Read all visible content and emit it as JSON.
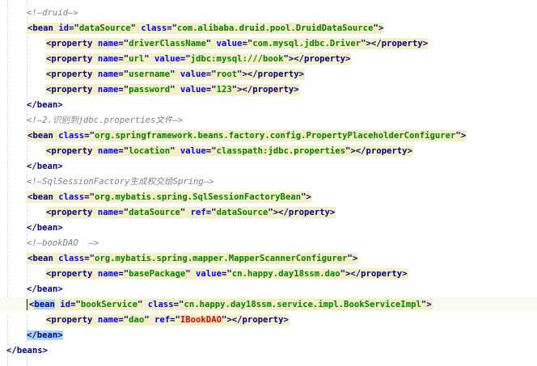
{
  "top_line_partial": "   <!- -------------------------------------------------------------------- ->",
  "lines": [
    {
      "type": "comment",
      "indent": 1,
      "text": "<!—druid—>"
    },
    {
      "type": "tag",
      "indent": 1,
      "open": "bean",
      "attrs": [
        {
          "n": "id",
          "v": "dataSource"
        },
        {
          "n": "class",
          "v": "com.alibaba.druid.pool.DruidDataSource"
        }
      ],
      "close": ">"
    },
    {
      "type": "tag",
      "indent": 2,
      "open": "property",
      "attrs": [
        {
          "n": "name",
          "v": "driverClassName"
        },
        {
          "n": "value",
          "v": "com.mysql.jdbc.Driver"
        }
      ],
      "close": "></property>"
    },
    {
      "type": "tag",
      "indent": 2,
      "open": "property",
      "attrs": [
        {
          "n": "name",
          "v": "url"
        },
        {
          "n": "value",
          "v": "jdbc:mysql:///book"
        }
      ],
      "close": "></property>"
    },
    {
      "type": "tag",
      "indent": 2,
      "open": "property",
      "attrs": [
        {
          "n": "name",
          "v": "username"
        },
        {
          "n": "value",
          "v": "root"
        }
      ],
      "close": "></property>"
    },
    {
      "type": "tag",
      "indent": 2,
      "open": "property",
      "attrs": [
        {
          "n": "name",
          "v": "password"
        },
        {
          "n": "value",
          "v": "123"
        }
      ],
      "close": "></property>"
    },
    {
      "type": "end",
      "indent": 1,
      "text": "</bean>"
    },
    {
      "type": "comment",
      "indent": 1,
      "text": "<!—2.识别到jdbc.properties文件—>"
    },
    {
      "type": "tag",
      "indent": 1,
      "open": "bean",
      "attrs": [
        {
          "n": "class",
          "v": "org.springframework.beans.factory.config.PropertyPlaceholderConfigurer"
        }
      ],
      "close": ">"
    },
    {
      "type": "tag",
      "indent": 2,
      "open": "property",
      "attrs": [
        {
          "n": "name",
          "v": "location"
        },
        {
          "n": "value",
          "v": "classpath:jdbc.properties"
        }
      ],
      "close": "></property>"
    },
    {
      "type": "end",
      "indent": 1,
      "text": "</bean>"
    },
    {
      "type": "comment",
      "indent": 1,
      "text": "<!—SqlSessionFactory生成权交给Spring—>"
    },
    {
      "type": "tag",
      "indent": 1,
      "open": "bean",
      "attrs": [
        {
          "n": "class",
          "v": "org.mybatis.spring.SqlSessionFactoryBean"
        }
      ],
      "close": ">"
    },
    {
      "type": "tag",
      "indent": 2,
      "open": "property",
      "attrs": [
        {
          "n": "name",
          "v": "dataSource"
        },
        {
          "n": "ref",
          "v": "dataSource"
        }
      ],
      "close": "></property>"
    },
    {
      "type": "end",
      "indent": 1,
      "text": "</bean>"
    },
    {
      "type": "comment",
      "indent": 1,
      "text": "<!—bookDAO  —>"
    },
    {
      "type": "tag",
      "indent": 1,
      "open": "bean",
      "attrs": [
        {
          "n": "class",
          "v": "org.mybatis.spring.mapper.MapperScannerConfigurer"
        }
      ],
      "close": ">"
    },
    {
      "type": "tag",
      "indent": 2,
      "open": "property",
      "attrs": [
        {
          "n": "name",
          "v": "basePackage"
        },
        {
          "n": "value",
          "v": "cn.happy.day18ssm.dao"
        }
      ],
      "close": "></property>"
    },
    {
      "type": "end",
      "indent": 1,
      "text": "</bean>"
    },
    {
      "type": "tag",
      "indent": 1,
      "open": "bean",
      "attrs": [
        {
          "n": "id",
          "v": "bookService"
        },
        {
          "n": "class",
          "v": "cn.happy.day18ssm.service.impl.BookServiceImpl"
        }
      ],
      "close": ">",
      "caret": true,
      "matched": true
    },
    {
      "type": "tag",
      "indent": 2,
      "open": "property",
      "attrs": [
        {
          "n": "name",
          "v": "dao"
        },
        {
          "n": "ref",
          "v": "IBookDAO",
          "err": true
        }
      ],
      "close": "></property>"
    },
    {
      "type": "end",
      "indent": 1,
      "text": "</bean>",
      "matched": true
    },
    {
      "type": "end",
      "indent": 0,
      "text": "</beans>"
    }
  ]
}
